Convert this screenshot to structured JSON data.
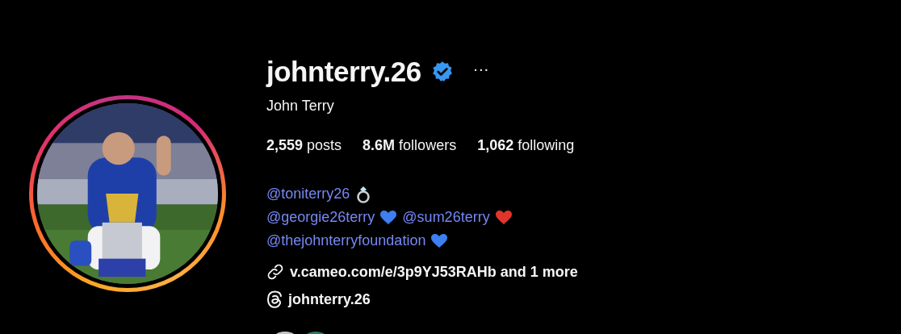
{
  "profile": {
    "username": "johnterry.26",
    "verified": true,
    "more": "···",
    "full_name": "John Terry",
    "stats": [
      {
        "count": "2,559",
        "label": "posts"
      },
      {
        "count": "8.6M",
        "label": "followers"
      },
      {
        "count": "1,062",
        "label": "following"
      }
    ],
    "bio": [
      [
        {
          "kind": "mention",
          "text": "@toniterry26"
        },
        {
          "kind": "ring"
        }
      ],
      [
        {
          "kind": "mention",
          "text": "@georgie26terry"
        },
        {
          "kind": "heart",
          "color": "#3d7ff0"
        },
        {
          "kind": "mention",
          "text": "@sum26terry"
        },
        {
          "kind": "heart",
          "color": "#e0352b"
        }
      ],
      [
        {
          "kind": "mention",
          "text": "@thejohnterryfoundation"
        },
        {
          "kind": "heart",
          "color": "#3d7ff0"
        }
      ]
    ],
    "link": "v.cameo.com/e/3p9YJ53RAHb and 1 more",
    "threads": "johnterry.26",
    "followed_by": [
      {
        "kind": "picture"
      },
      {
        "kind": "picture"
      }
    ]
  }
}
